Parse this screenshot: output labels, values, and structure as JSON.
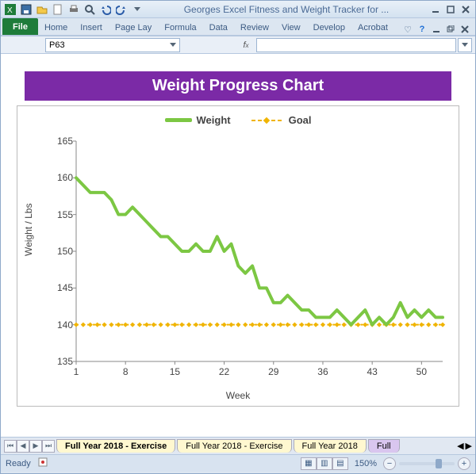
{
  "window_title": "Georges Excel Fitness and Weight Tracker for ...",
  "ribbon": {
    "tabs": [
      "File",
      "Home",
      "Insert",
      "Page Lay",
      "Formula",
      "Data",
      "Review",
      "View",
      "Develop",
      "Acrobat"
    ]
  },
  "name_box": "P63",
  "formula_bar_value": "",
  "chart_title": "Weight Progress Chart",
  "legend": {
    "series1": "Weight",
    "series2": "Goal"
  },
  "ylabel": "Weight / Lbs",
  "xlabel": "Week",
  "yticks": [
    "165",
    "160",
    "155",
    "150",
    "145",
    "140",
    "135"
  ],
  "xticks": [
    "1",
    "8",
    "15",
    "22",
    "29",
    "36",
    "43",
    "50"
  ],
  "sheet_tabs": [
    "Full Year 2018 - Exercise",
    "Full Year 2018 - Exercise",
    "Full Year 2018",
    "Full"
  ],
  "status_ready": "Ready",
  "zoom_pct": "150%",
  "chart_data": {
    "type": "line",
    "title": "Weight Progress Chart",
    "xlabel": "Week",
    "ylabel": "Weight / Lbs",
    "ylim": [
      135,
      165
    ],
    "xlim": [
      1,
      53
    ],
    "x": [
      1,
      2,
      3,
      4,
      5,
      6,
      7,
      8,
      9,
      10,
      11,
      12,
      13,
      14,
      15,
      16,
      17,
      18,
      19,
      20,
      21,
      22,
      23,
      24,
      25,
      26,
      27,
      28,
      29,
      30,
      31,
      32,
      33,
      34,
      35,
      36,
      37,
      38,
      39,
      40,
      41,
      42,
      43,
      44,
      45,
      46,
      47,
      48,
      49,
      50,
      51,
      52,
      53
    ],
    "series": [
      {
        "name": "Weight",
        "style": "solid",
        "color": "#7cc743",
        "values": [
          160,
          159,
          158,
          158,
          158,
          157,
          155,
          155,
          156,
          155,
          154,
          153,
          152,
          152,
          151,
          150,
          150,
          151,
          150,
          150,
          152,
          150,
          151,
          148,
          147,
          148,
          145,
          145,
          143,
          143,
          144,
          143,
          142,
          142,
          141,
          141,
          141,
          142,
          141,
          140,
          141,
          142,
          140,
          141,
          140,
          141,
          143,
          141,
          142,
          141,
          142,
          141,
          141
        ]
      },
      {
        "name": "Goal",
        "style": "dotted",
        "color": "#f0b400",
        "values": [
          140,
          140,
          140,
          140,
          140,
          140,
          140,
          140,
          140,
          140,
          140,
          140,
          140,
          140,
          140,
          140,
          140,
          140,
          140,
          140,
          140,
          140,
          140,
          140,
          140,
          140,
          140,
          140,
          140,
          140,
          140,
          140,
          140,
          140,
          140,
          140,
          140,
          140,
          140,
          140,
          140,
          140,
          140,
          140,
          140,
          140,
          140,
          140,
          140,
          140,
          140,
          140,
          140
        ]
      }
    ],
    "xticks": [
      1,
      8,
      15,
      22,
      29,
      36,
      43,
      50
    ]
  }
}
